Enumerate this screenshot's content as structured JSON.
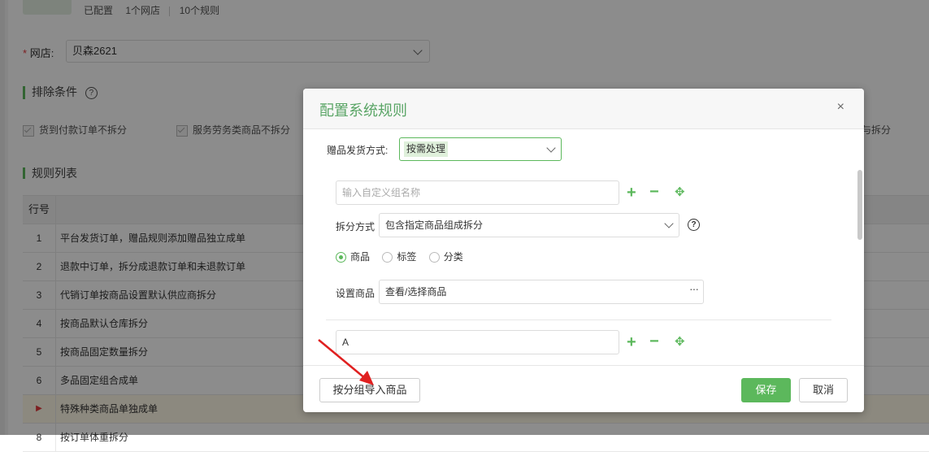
{
  "header": {
    "configured": "已配置",
    "shop_count": "1个网店",
    "rule_count": "10个规则"
  },
  "shop": {
    "required_mark": "*",
    "label": "网店:",
    "value": "贝森2621"
  },
  "exclude": {
    "title": "排除条件",
    "help": "?",
    "options": [
      "货到付款订单不拆分",
      "服务劳务类商品不拆分"
    ],
    "tail_text": "与拆分"
  },
  "rules": {
    "title": "规则列表",
    "col_no": "行号",
    "rows": [
      {
        "no": "1",
        "name": "平台发货订单，赠品规则添加赠品独立成单"
      },
      {
        "no": "2",
        "name": "退款中订单，拆分成退款订单和未退款订单"
      },
      {
        "no": "3",
        "name": "代销订单按商品设置默认供应商拆分"
      },
      {
        "no": "4",
        "name": "按商品默认仓库拆分"
      },
      {
        "no": "5",
        "name": "按商品固定数量拆分"
      },
      {
        "no": "6",
        "name": "多品固定组合成单"
      },
      {
        "no": "▶",
        "name": "特殊种类商品单独成单"
      },
      {
        "no": "8",
        "name": "按订单体重拆分"
      }
    ]
  },
  "modal": {
    "title": "配置系统规则",
    "close": "×",
    "gift_label": "赠品发货方式:",
    "gift_value": "按需处理",
    "group_name_placeholder": "输入自定义组名称",
    "split_label": "拆分方式",
    "split_value": "包含指定商品组成拆分",
    "split_help": "?",
    "radios": [
      {
        "label": "商品",
        "checked": true
      },
      {
        "label": "标签",
        "checked": false
      },
      {
        "label": "分类",
        "checked": false
      }
    ],
    "goods_label": "设置商品",
    "goods_value": "查看/选择商品",
    "goods_more": "···",
    "group2_name": "A",
    "plus": "+",
    "minus": "−",
    "move": "✥",
    "import_btn": "按分组导入商品",
    "save_btn": "保存",
    "cancel_btn": "取消"
  },
  "colors": {
    "accent": "#5cb85c",
    "title_green": "#5aa566",
    "annotation_arrow": "#e02020"
  }
}
